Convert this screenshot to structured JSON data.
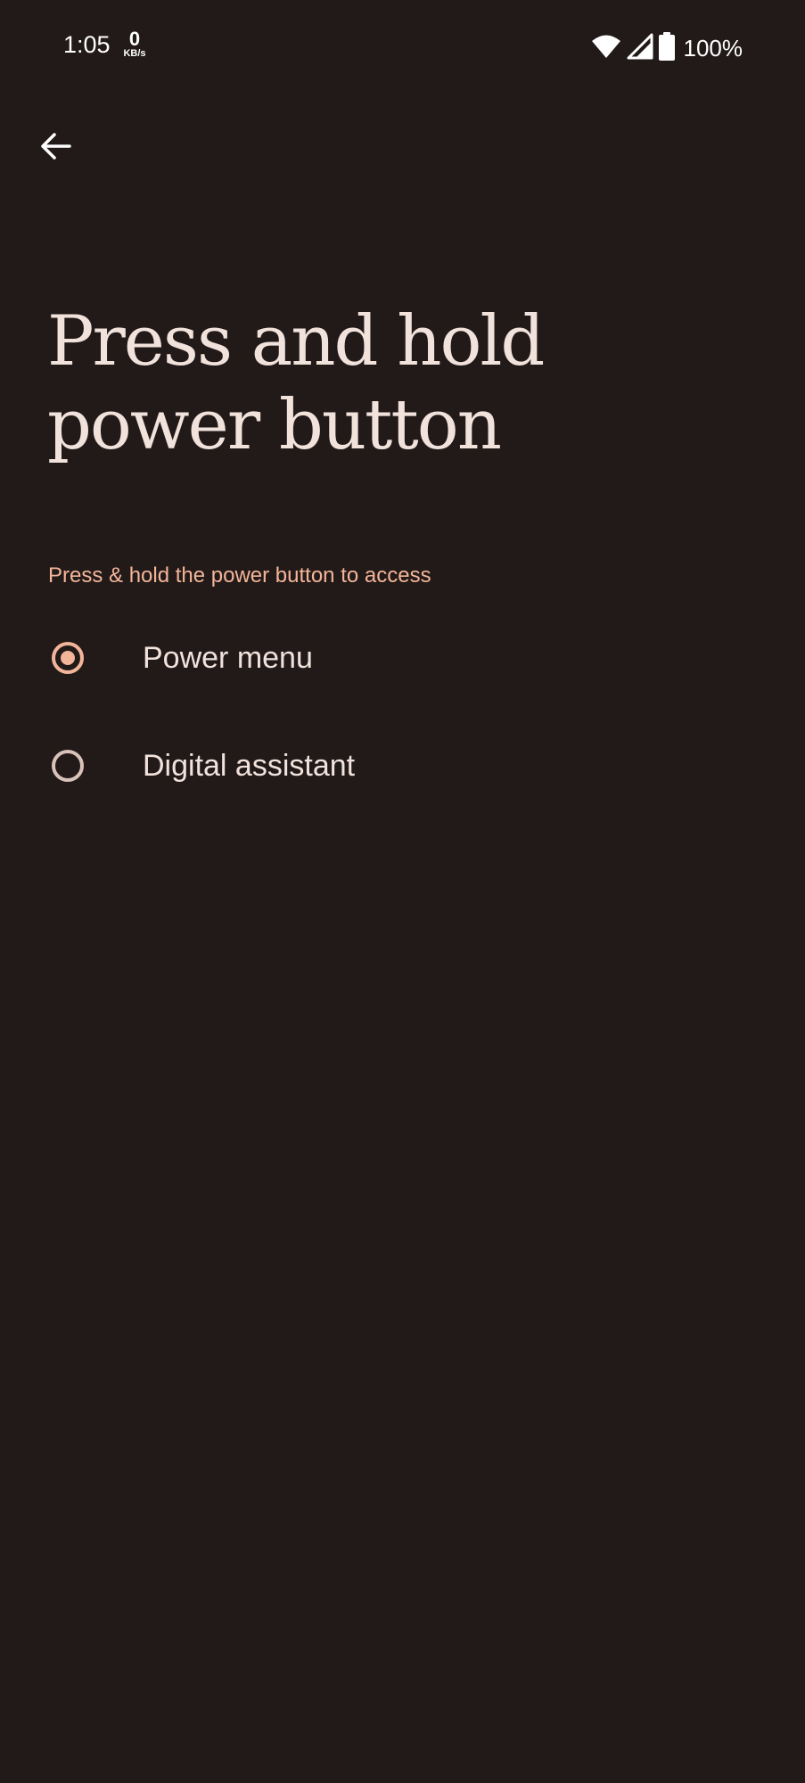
{
  "status_bar": {
    "time": "1:05",
    "net_speed_value": "0",
    "net_speed_unit": "KB/s",
    "wifi_icon": "wifi-icon",
    "signal_icon": "cell-signal-icon",
    "battery_icon": "battery-full-icon",
    "battery_level": "100%"
  },
  "toolbar": {
    "back_icon": "arrow-back-icon"
  },
  "page": {
    "title": "Press and hold power button",
    "section_header": "Press & hold the power button to access"
  },
  "options": [
    {
      "label": "Power menu",
      "selected": true
    },
    {
      "label": "Digital assistant",
      "selected": false
    }
  ],
  "colors": {
    "background": "#221a18",
    "accent": "#f3b599",
    "text_primary": "#f1e2dc",
    "radio_unchecked": "#d9c2ba"
  }
}
